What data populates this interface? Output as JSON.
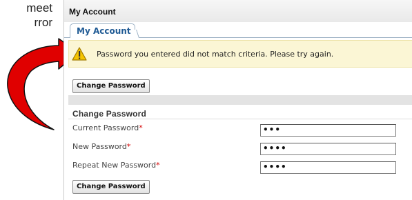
{
  "annotation": {
    "line1": "meet",
    "line2": "rror"
  },
  "window": {
    "title": "My Account"
  },
  "tabs": [
    {
      "label": "My Account"
    }
  ],
  "alert": {
    "message": "Password you entered did not match criteria. Please try again.",
    "icon": "warning-icon"
  },
  "toolbar": {
    "change_password_label": "Change Password"
  },
  "form": {
    "section_title": "Change Password",
    "required_marker": "*",
    "fields": [
      {
        "label": "Current Password",
        "value": "•••"
      },
      {
        "label": "New Password",
        "value": "••••"
      },
      {
        "label": "Repeat New Password",
        "value": "••••"
      }
    ],
    "submit_label": "Change Password"
  },
  "colors": {
    "arrow": "#e00000",
    "tab_text": "#1f5a94",
    "alert_bg": "#fbf6d5",
    "required": "#d40000"
  }
}
